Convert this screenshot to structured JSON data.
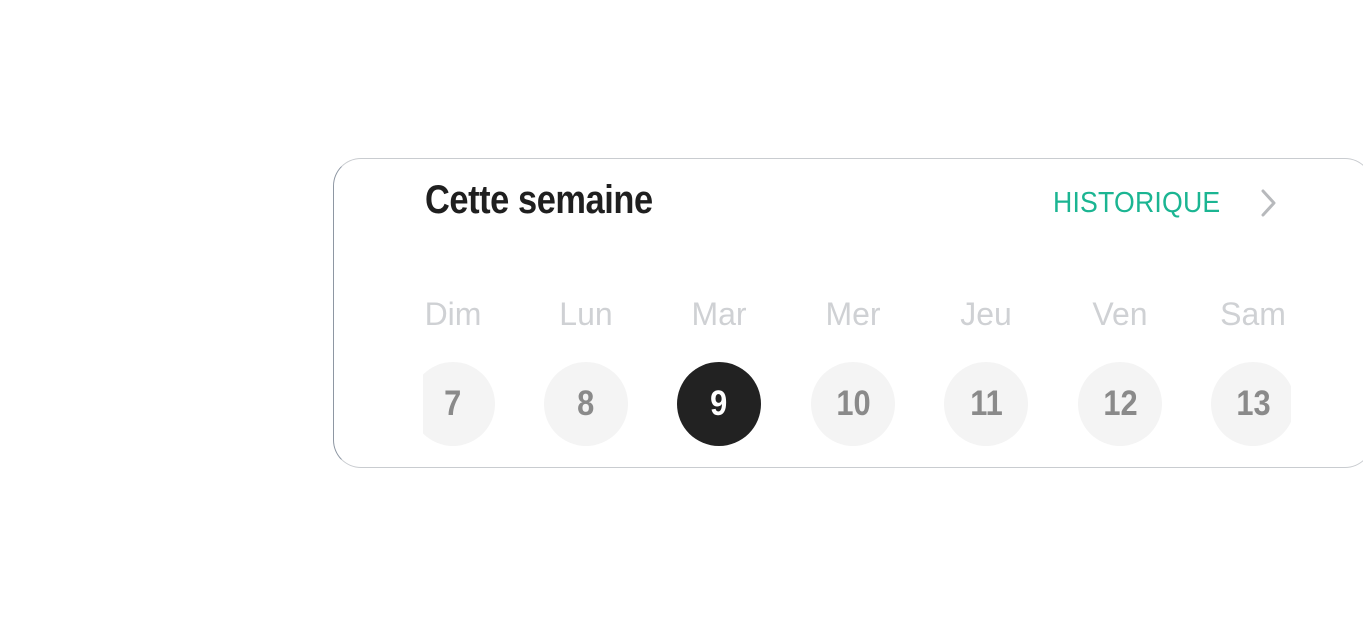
{
  "card": {
    "title": "Cette semaine",
    "history_link": {
      "label": "HISTORIQUE",
      "icon": "chevron-right-icon"
    }
  },
  "week": {
    "days": [
      {
        "name": "Dim",
        "number": "7"
      },
      {
        "name": "Lun",
        "number": "8"
      },
      {
        "name": "Mar",
        "number": "9"
      },
      {
        "name": "Mer",
        "number": "10"
      },
      {
        "name": "Jeu",
        "number": "11"
      },
      {
        "name": "Ven",
        "number": "12"
      },
      {
        "name": "Sam",
        "number": "13"
      }
    ],
    "selected_number": "9"
  },
  "colors": {
    "accent": "#1bb592",
    "selected_day_bg": "#222222",
    "day_bg": "#f4f4f4",
    "title": "#1f1f1f",
    "day_name": "#cfd1d4",
    "day_number": "#8a8a8a"
  }
}
